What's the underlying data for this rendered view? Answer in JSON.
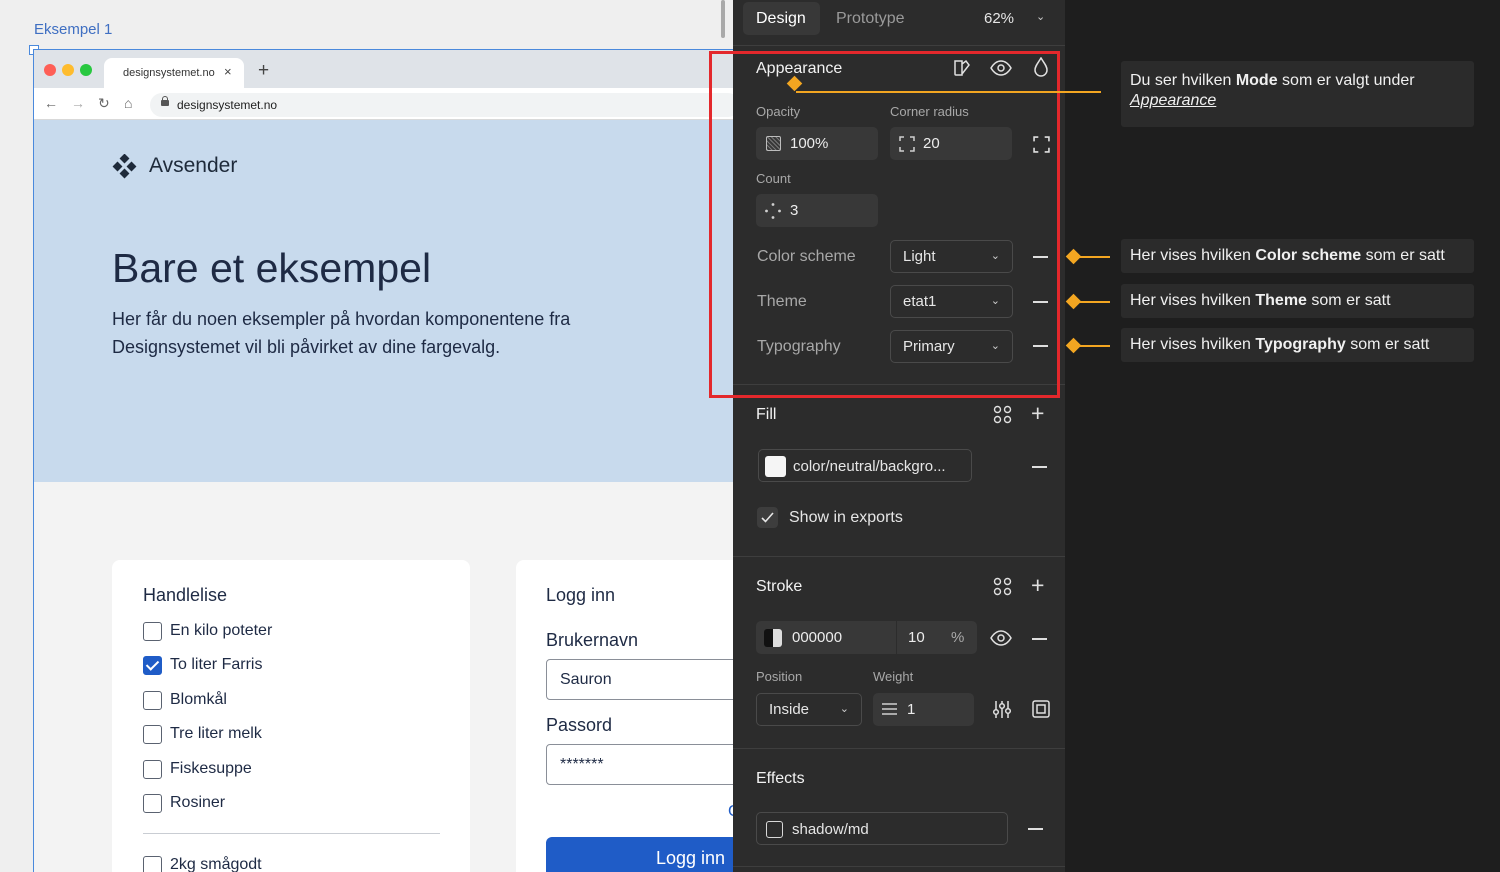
{
  "canvas": {
    "frame_label": "Eksempel 1",
    "browser": {
      "tab_title": "designsystemet.no",
      "tab_close": "×",
      "new_tab": "+",
      "nav": {
        "back": "←",
        "forward": "→",
        "reload": "↻",
        "home": "⌂"
      },
      "url": "designsystemet.no",
      "traffic_colors": [
        "#fe5f57",
        "#febc2e",
        "#28c840"
      ]
    },
    "hero": {
      "sender": "Avsender",
      "title": "Bare et eksempel",
      "text": "Her får du noen eksempler på hvordan komponentene fra Designsystemet vil bli påvirket av dine fargevalg."
    },
    "shopping": {
      "title": "Handlelise",
      "items": [
        {
          "label": "En kilo poteter",
          "checked": false
        },
        {
          "label": "To liter Farris",
          "checked": true
        },
        {
          "label": "Blomkål",
          "checked": false
        },
        {
          "label": "Tre liter melk",
          "checked": false
        },
        {
          "label": "Fiskesuppe",
          "checked": false
        },
        {
          "label": "Rosiner",
          "checked": false
        }
      ],
      "extra_item": "2kg smågodt"
    },
    "login": {
      "title": "Logg inn",
      "username_label": "Brukernavn",
      "username_value": "Sauron",
      "password_label": "Passord",
      "password_value": "*******",
      "link_fragment": "G",
      "button": "Logg inn"
    }
  },
  "panel": {
    "tabs": {
      "design": "Design",
      "prototype": "Prototype"
    },
    "zoom": "62%",
    "appearance": {
      "title": "Appearance",
      "opacity_label": "Opacity",
      "opacity_value": "100%",
      "corner_radius_label": "Corner radius",
      "corner_radius_value": "20",
      "count_label": "Count",
      "count_value": "3",
      "color_scheme_label": "Color scheme",
      "color_scheme_value": "Light",
      "theme_label": "Theme",
      "theme_value": "etat1",
      "typography_label": "Typography",
      "typography_value": "Primary"
    },
    "fill": {
      "title": "Fill",
      "color_name": "color/neutral/backgro...",
      "show_in_exports": "Show in exports"
    },
    "stroke": {
      "title": "Stroke",
      "hex": "000000",
      "opacity": "10",
      "percent": "%",
      "position_label": "Position",
      "position_value": "Inside",
      "weight_label": "Weight",
      "weight_value": "1"
    },
    "effects": {
      "title": "Effects",
      "effect_name": "shadow/md"
    }
  },
  "annotations": {
    "mode": {
      "pre": "Du ser hvilken ",
      "bold": "Mode",
      "post": " som er valgt under",
      "link": "Appearance"
    },
    "color_scheme": {
      "pre": "Her vises hvilken ",
      "bold": "Color scheme",
      "post": " som er satt"
    },
    "theme": {
      "pre": "Her vises hvilken ",
      "bold": "Theme",
      "post": " som er satt"
    },
    "typography": {
      "pre": "Her vises hvilken ",
      "bold": "Typography",
      "post": " som er satt"
    }
  },
  "colors": {
    "highlight": "#e3282c",
    "annotation_accent": "#f3a621",
    "primary": "#1f5cc7",
    "hero_bg": "#c8daed"
  }
}
